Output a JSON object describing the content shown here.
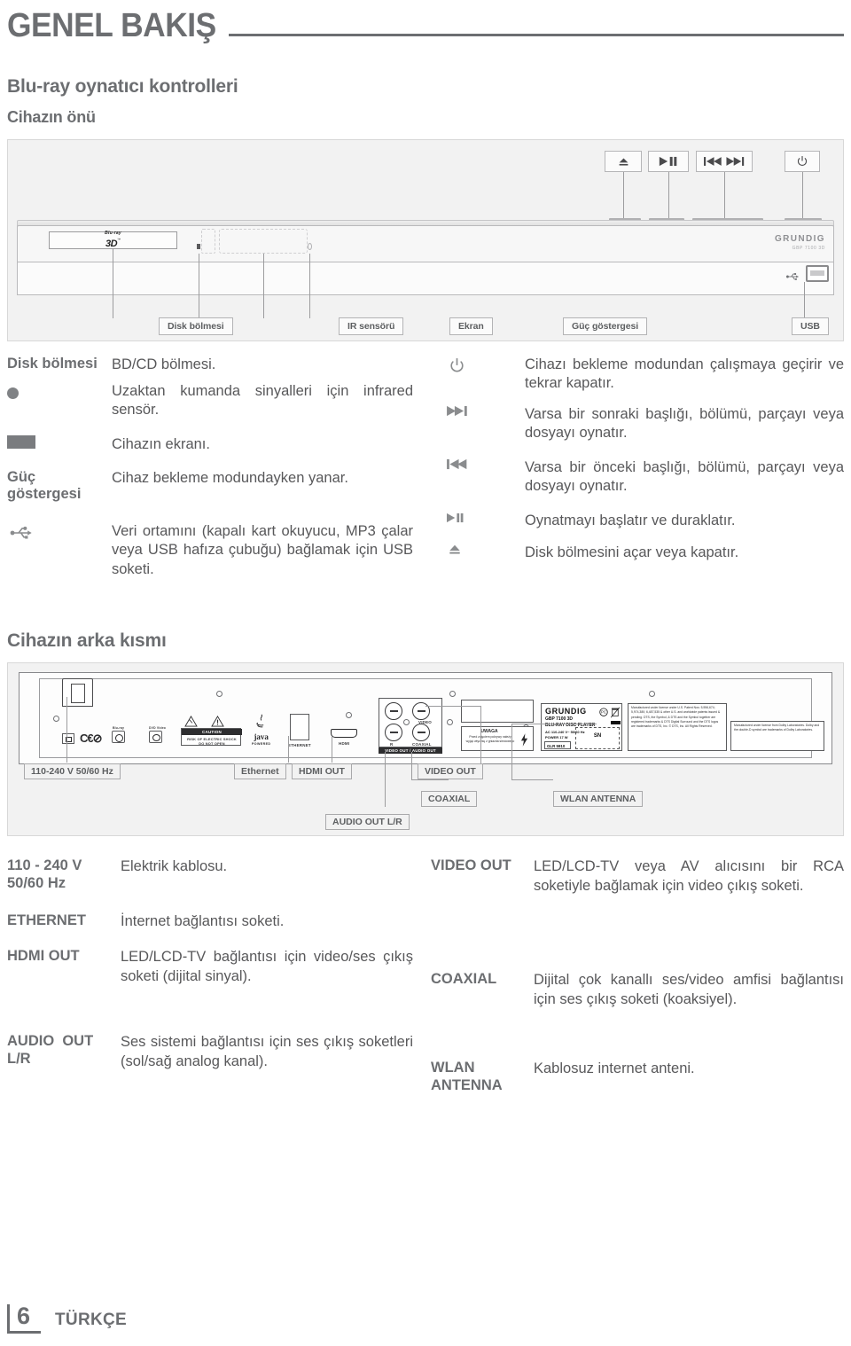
{
  "header": {
    "chapter": "GENEL BAKIŞ",
    "section": "Blu-ray oynatıcı kontrolleri",
    "subsection": "Cihazın önü"
  },
  "front_figure": {
    "brand": "GRUNDIG",
    "model_small": "GBP 7100 3D",
    "disc_logo_top": "Blu-ray",
    "disc_logo_main": "3D",
    "disc_logo_tm": "™",
    "top_buttons": [
      {
        "name": "eject-button",
        "glyph": "⏏"
      },
      {
        "name": "play-pause-button",
        "glyph": "▶❙❙"
      },
      {
        "name": "skip-prev-next-button",
        "glyph": "❙◀◀ ▶▶❙"
      },
      {
        "name": "standby-button",
        "glyph": "⏻"
      }
    ],
    "callouts": [
      {
        "label": "Disk bölmesi",
        "name": "callout-disc-tray"
      },
      {
        "label": "IR sensörü",
        "name": "callout-ir-sensor"
      },
      {
        "label": "Ekran",
        "name": "callout-display"
      },
      {
        "label": "Güç göstergesi",
        "name": "callout-power-indicator"
      },
      {
        "label": "USB",
        "name": "callout-usb"
      }
    ]
  },
  "front_table": {
    "left": [
      {
        "key": "Disk bölmesi",
        "key_type": "text",
        "value": "BD/CD bölmesi."
      },
      {
        "key": "",
        "key_type": "dot-icon",
        "value": "Uzaktan kumanda sinyalleri için infrared sensör."
      },
      {
        "key": "",
        "key_type": "rect-icon",
        "value": "Cihazın ekranı."
      },
      {
        "key": "Güç göstergesi",
        "key_type": "text",
        "value": "Cihaz bekleme modundayken yanar."
      },
      {
        "key": "",
        "key_type": "usb-icon",
        "value": "Veri ortamını (kapalı kart okuyucu, MP3 çalar veya USB hafıza çubuğu) bağlamak için USB soketi."
      }
    ],
    "right": [
      {
        "key": "",
        "key_type": "power-icon",
        "value": "Cihazı bekleme modundan çalışmaya geçirir ve tekrar kapatır."
      },
      {
        "key": "",
        "key_type": "next-icon",
        "value": "Varsa bir sonraki başlığı, bölümü, parçayı veya dosyayı oynatır."
      },
      {
        "key": "",
        "key_type": "prev-icon",
        "value": "Varsa bir önceki başlığı, bölümü, parçayı veya dosyayı oynatır."
      },
      {
        "key": "",
        "key_type": "playpause-icon",
        "value": "Oynatmayı başlatır ve duraklatır."
      },
      {
        "key": "",
        "key_type": "eject-icon",
        "value": "Disk bölmesini açar veya kapatır."
      }
    ]
  },
  "rear": {
    "heading": "Cihazın arka kısmı",
    "panel_labels": {
      "ethernet": "ETHERNET",
      "hdmi": "HDMI",
      "video_out_audio_out": "VIDEO OUT / AUDIO OUT",
      "video": "VIDEO",
      "coaxial": "COAXIAL",
      "r_channel": "R",
      "caution_title": "CAUTION",
      "caution_l1": "RISK OF ELECTRIC SHOCK",
      "caution_l2": "DO NOT OPEN",
      "java": "java",
      "java_sub": "POWERED",
      "uwaga_title": "UWAGA",
      "uwaga_body": "Przed zdjęciem pokrywy należy wyjąć wtyczkę z gniazda sieciowego",
      "brand": "GRUNDIG",
      "model": "GBP 7100 3D",
      "type": "BLU-RAY DISC PLAYER",
      "voltage": "AC 110-240 V~  50/60 Hz",
      "power": "POWER 17 W",
      "code": "GLR 5910",
      "sn": "SN",
      "dts_notice": "Manufactured under license under U.S. Patent Nos: 5,956,674; 5,974,380; 6,487,535 & other U.S. and worldwide patents issued & pending. DTS, the Symbol, & DTS and the Symbol together are registered trademarks & DTS Digital Surround and the DTS logos are trademarks of DTS, Inc. © DTS, Inc. All Rights Reserved.",
      "dolby_notice": "Manufactured under license from Dolby Laboratories. Dolby and the double-D symbol are trademarks of Dolby Laboratories."
    },
    "callouts": [
      {
        "label": "110-240 V 50/60 Hz",
        "name": "callout-power-input"
      },
      {
        "label": "Ethernet",
        "name": "callout-ethernet"
      },
      {
        "label": "HDMI OUT",
        "name": "callout-hdmi-out"
      },
      {
        "label": "VIDEO OUT",
        "name": "callout-video-out"
      },
      {
        "label": "COAXIAL",
        "name": "callout-coaxial"
      },
      {
        "label": "AUDIO OUT L/R",
        "name": "callout-audio-out-lr"
      },
      {
        "label": "WLAN ANTENNA",
        "name": "callout-wlan-antenna"
      }
    ]
  },
  "rear_table": {
    "left": [
      {
        "key": "110 - 240 V 50/60 Hz",
        "value": "Elektrik kablosu."
      },
      {
        "key": "ETHERNET",
        "value": "İnternet bağlantısı soketi."
      },
      {
        "key": "HDMI OUT",
        "value": "LED/LCD-TV bağlantısı için video/ses çıkış soketi (dijital sinyal)."
      },
      {
        "key": "AUDIO OUT L/R",
        "value": "Ses sistemi bağlantısı için ses çıkış soketleri (sol/sağ analog kanal)."
      }
    ],
    "right": [
      {
        "key": "VIDEO OUT",
        "value": "LED/LCD-TV veya AV alıcısını bir RCA soketiyle bağlamak için video çıkış soketi."
      },
      {
        "key": "COAXIAL",
        "value": "Dijital çok kanallı ses/video amfisi bağlantısı için ses çıkış soketi (koaksiyel)."
      },
      {
        "key": "WLAN ANTENNA",
        "value": "Kablosuz internet anteni."
      }
    ]
  },
  "footer": {
    "page": "6",
    "language": "TÜRKÇE"
  },
  "colors": {
    "ink": "#6c6e71",
    "body": "#58585a",
    "figure_bg": "#f2f2f2"
  }
}
